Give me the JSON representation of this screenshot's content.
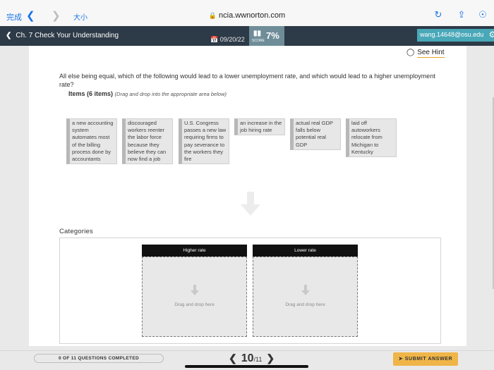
{
  "browser": {
    "done_label": "完成",
    "text_size_label": "大小",
    "url": "ncia.wwnorton.com",
    "back_icon": "chevron-left-icon",
    "forward_icon": "chevron-right-icon"
  },
  "appbar": {
    "title": "Ch. 7 Check Your Understanding",
    "date": "09/20/22",
    "score_label": "SCORE",
    "score_value": "7%",
    "user": "wang.14648@osu.edu"
  },
  "hint": {
    "label": "See Hint"
  },
  "question": {
    "text": "All else being equal, which of the following would lead to a lower unemployment rate, and which would lead to a higher unemployment rate?",
    "items_heading": "Items (6 items)",
    "items_instruction": "(Drag and drop into the appropriate area below)"
  },
  "items": [
    "a new accounting system automates most of the billing process done by accountants",
    "discouraged workers reenter the labor force because they believe they can now find a job",
    "U.S. Congress passes a new law requiring firms to pay severance to the workers they fire",
    "an increase in the job hiring rate",
    "actual real GDP falls below potential real GDP",
    "laid off autoworkers relocate from Michigan to Kentucky"
  ],
  "categories": {
    "label": "Categories",
    "higher": "Higher rate",
    "lower": "Lower rate",
    "drop_text": "Drag and drop here"
  },
  "footer": {
    "progress": "0 OF 11 QUESTIONS COMPLETED",
    "current": "10",
    "total": "/11",
    "submit": "SUBMIT ANSWER"
  },
  "colors": {
    "appbar": "#2d3a47",
    "score_box": "#6f8d99",
    "user_box": "#49a8b8",
    "submit": "#f0b548",
    "hint_underline": "#e8a425"
  }
}
